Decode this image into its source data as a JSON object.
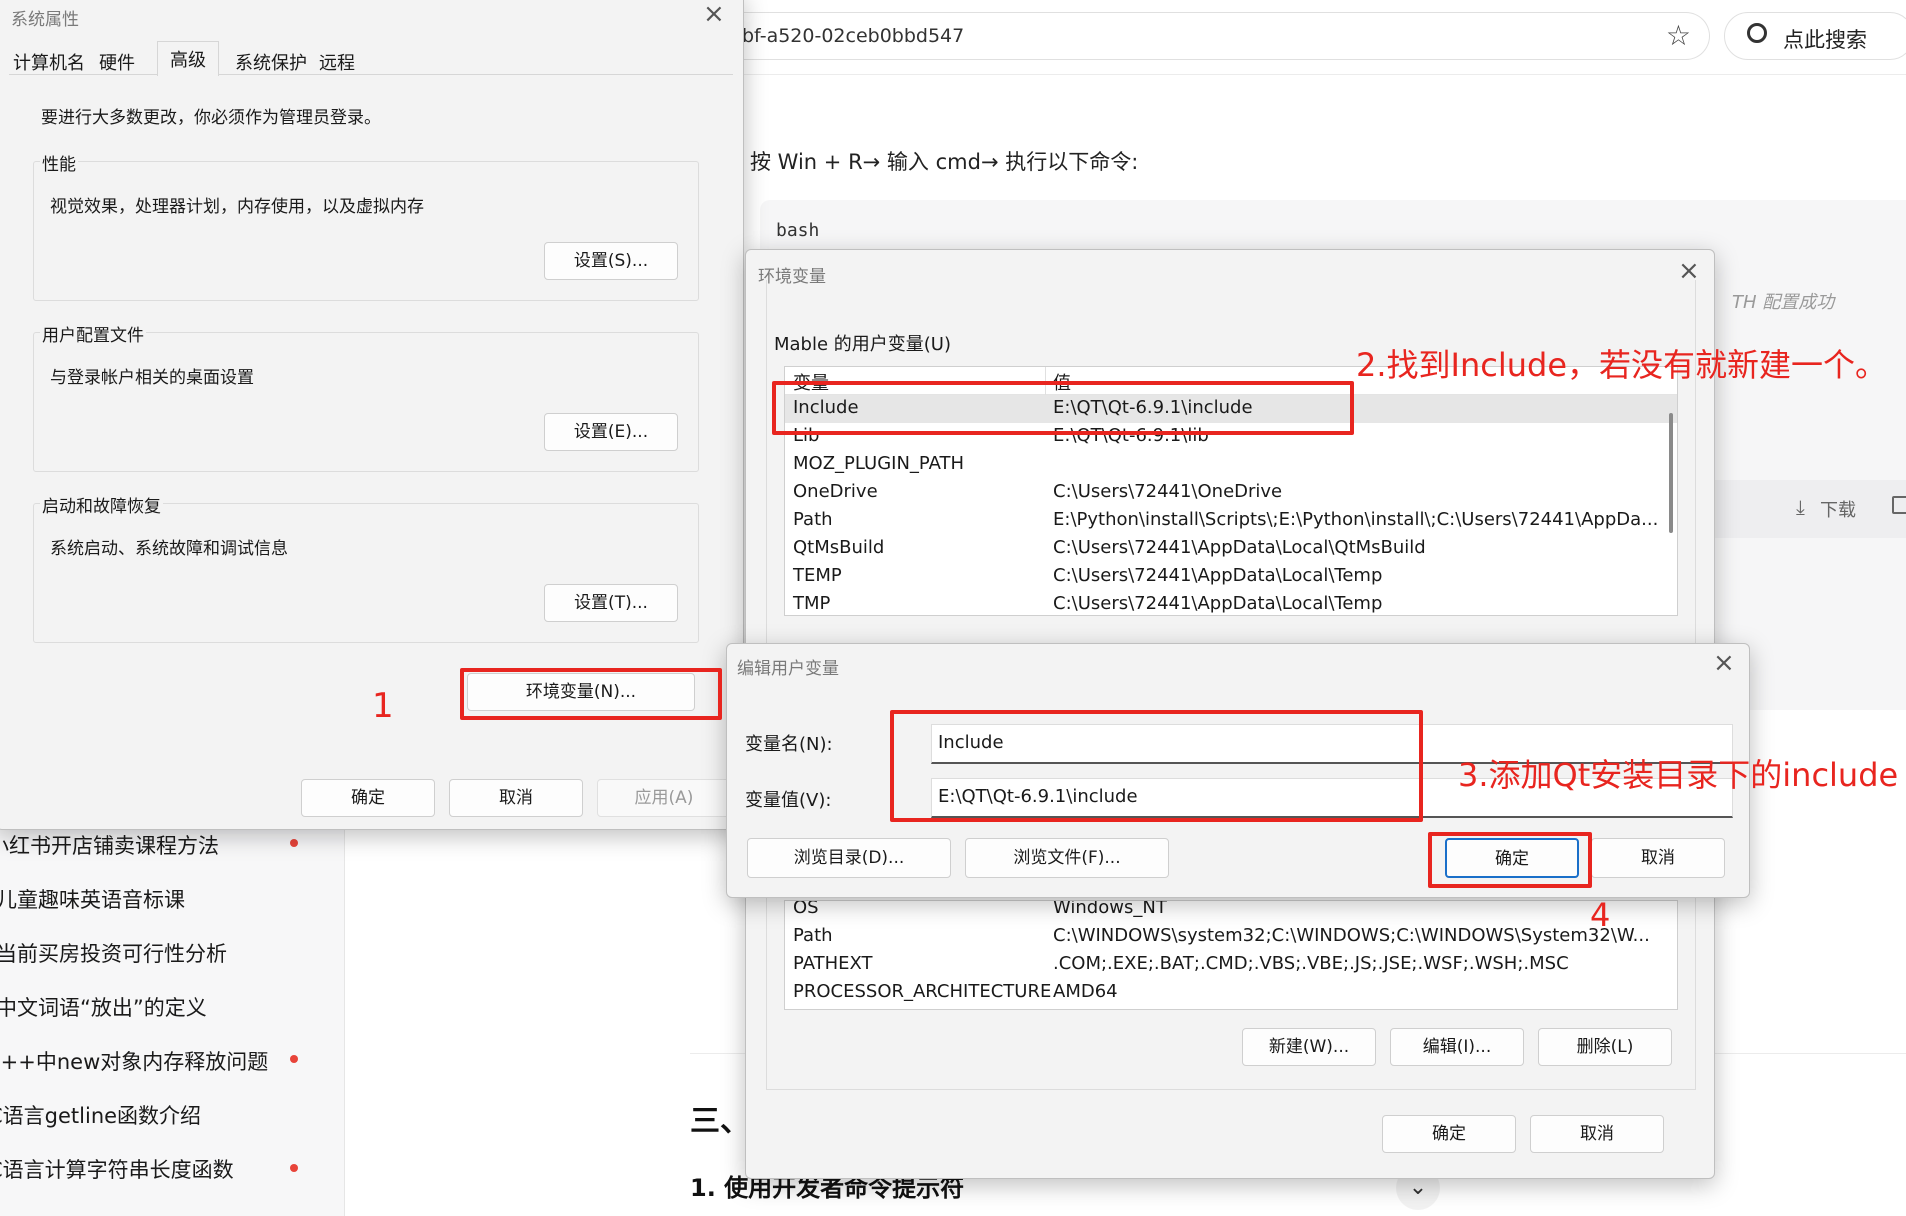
{
  "browser": {
    "url_tail": "bf-a520-02ceb0bbd547",
    "search_label": "点此搜索",
    "star_icon": "star-icon",
    "search_icon": "search-icon"
  },
  "article": {
    "code_intro": "按 Win + R→ 输入 cmd→ 执行以下命令:",
    "code_lang": "bash",
    "comment_text": "TH  配置成功",
    "download_label": "下载",
    "heading_three": "三、",
    "heading_sub": "1. 使用开发者命令提示符"
  },
  "sidebar": {
    "items": [
      {
        "label": "小红书开店铺卖课程方法",
        "dot": true
      },
      {
        "label": "儿童趣味英语音标课",
        "dot": false
      },
      {
        "label": "当前买房投资可行性分析",
        "dot": false
      },
      {
        "label": "中文词语“放出”的定义",
        "dot": false
      },
      {
        "label": "C++中new对象内存释放问题",
        "dot": true
      },
      {
        "label": "C语言getline函数介绍",
        "dot": false
      },
      {
        "label": "C语言计算字符串长度函数",
        "dot": true
      }
    ]
  },
  "sysprops": {
    "title": "系统属性",
    "tabs": [
      "计算机名",
      "硬件",
      "高级",
      "系统保护",
      "远程"
    ],
    "active_tab": "高级",
    "admin_note": "要进行大多数更改，你必须作为管理员登录。",
    "groups": [
      {
        "label": "性能",
        "desc": "视觉效果，处理器计划，内存使用，以及虚拟内存",
        "button": "设置(S)..."
      },
      {
        "label": "用户配置文件",
        "desc": "与登录帐户相关的桌面设置",
        "button": "设置(E)..."
      },
      {
        "label": "启动和故障恢复",
        "desc": "系统启动、系统故障和调试信息",
        "button": "设置(T)..."
      }
    ],
    "env_button": "环境变量(N)...",
    "ok": "确定",
    "cancel": "取消",
    "apply": "应用(A)"
  },
  "envvars": {
    "title": "环境变量",
    "user_section": "Mable 的用户变量(U)",
    "col_name": "变量",
    "col_value": "值",
    "user_vars": [
      {
        "name": "Include",
        "value": "E:\\QT\\Qt-6.9.1\\include"
      },
      {
        "name": "Lib",
        "value": "E:\\QT\\Qt-6.9.1\\lib"
      },
      {
        "name": "MOZ_PLUGIN_PATH",
        "value": ""
      },
      {
        "name": "OneDrive",
        "value": "C:\\Users\\72441\\OneDrive"
      },
      {
        "name": "Path",
        "value": "E:\\Python\\install\\Scripts\\;E:\\Python\\install\\;C:\\Users\\72441\\AppDa..."
      },
      {
        "name": "QtMsBuild",
        "value": "C:\\Users\\72441\\AppData\\Local\\QtMsBuild"
      },
      {
        "name": "TEMP",
        "value": "C:\\Users\\72441\\AppData\\Local\\Temp"
      },
      {
        "name": "TMP",
        "value": "C:\\Users\\72441\\AppData\\Local\\Temp"
      }
    ],
    "system_vars": [
      {
        "name": "OS",
        "value": "Windows_NT"
      },
      {
        "name": "Path",
        "value": "C:\\WINDOWS\\system32;C:\\WINDOWS;C:\\WINDOWS\\System32\\W..."
      },
      {
        "name": "PATHEXT",
        "value": ".COM;.EXE;.BAT;.CMD;.VBS;.VBE;.JS;.JSE;.WSF;.WSH;.MSC"
      },
      {
        "name": "PROCESSOR_ARCHITECTURE",
        "value": "AMD64"
      }
    ],
    "new_button": "新建(W)...",
    "edit_button": "编辑(I)...",
    "delete_button": "删除(L)",
    "ok": "确定",
    "cancel": "取消"
  },
  "editvar": {
    "title": "编辑用户变量",
    "name_label": "变量名(N):",
    "name_value": "Include",
    "value_label": "变量值(V):",
    "value_value": "E:\\QT\\Qt-6.9.1\\include",
    "browse_dir": "浏览目录(D)...",
    "browse_file": "浏览文件(F)...",
    "ok": "确定",
    "cancel": "取消"
  },
  "annotations": {
    "step1": "1",
    "step2": "2.找到Include，若没有就新建一个。",
    "step3": "3.添加Qt安装目录下的include",
    "step4": "4",
    "color": "#e8251f"
  }
}
